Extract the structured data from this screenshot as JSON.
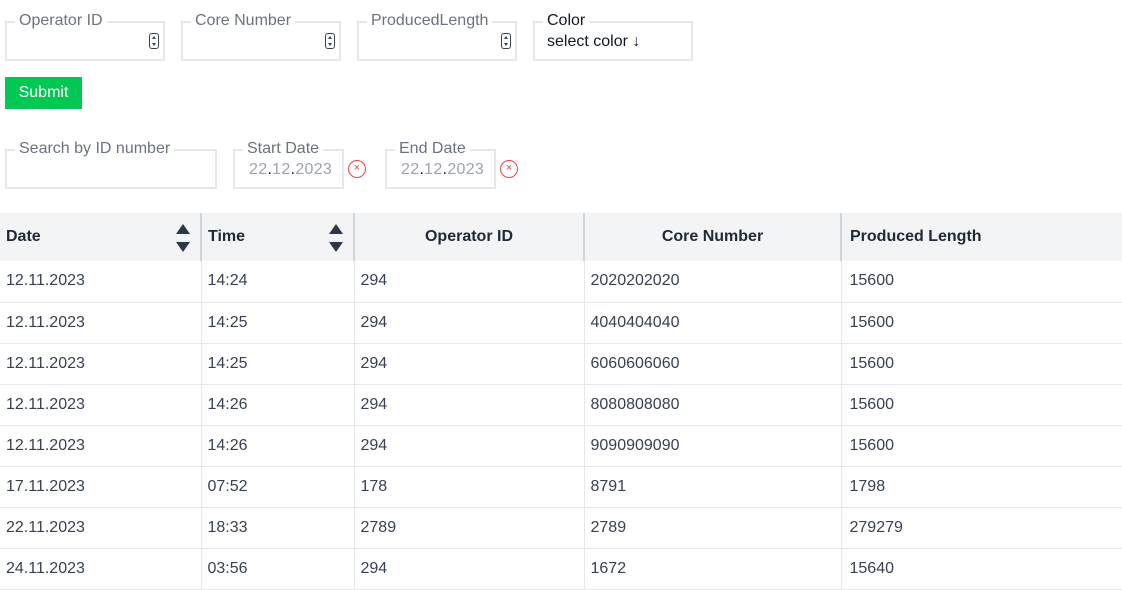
{
  "form": {
    "operator_id_label": "Operator ID",
    "core_number_label": "Core Number",
    "produced_length_label": "ProducedLength",
    "color_label": "Color",
    "color_value": "select color ↓",
    "submit_label": "Submit"
  },
  "filters": {
    "search_label": "Search by ID number",
    "start_date_label": "Start Date",
    "start_date_day": "22",
    "start_date_month": "12",
    "start_date_year": "2023",
    "end_date_label": "End Date",
    "end_date_day": "22",
    "end_date_month": "12",
    "end_date_year": "2023",
    "clear_glyph": "×"
  },
  "table": {
    "headers": [
      "Date",
      "Time",
      "Operator ID",
      "Core Number",
      "Produced Length"
    ],
    "rows": [
      [
        "12.11.2023",
        "14:24",
        "294",
        "2020202020",
        "15600"
      ],
      [
        "12.11.2023",
        "14:25",
        "294",
        "4040404040",
        "15600"
      ],
      [
        "12.11.2023",
        "14:25",
        "294",
        "6060606060",
        "15600"
      ],
      [
        "12.11.2023",
        "14:26",
        "294",
        "8080808080",
        "15600"
      ],
      [
        "12.11.2023",
        "14:26",
        "294",
        "9090909090",
        "15600"
      ],
      [
        "17.11.2023",
        "07:52",
        "178",
        "8791",
        "1798"
      ],
      [
        "22.11.2023",
        "18:33",
        "2789",
        "2789",
        "279279"
      ],
      [
        "24.11.2023",
        "03:56",
        "294",
        "1672",
        "15640"
      ]
    ]
  },
  "colors": {
    "submit_bg": "#00c853",
    "clear_icon": "#ef4444",
    "header_bg": "#f3f4f6"
  }
}
